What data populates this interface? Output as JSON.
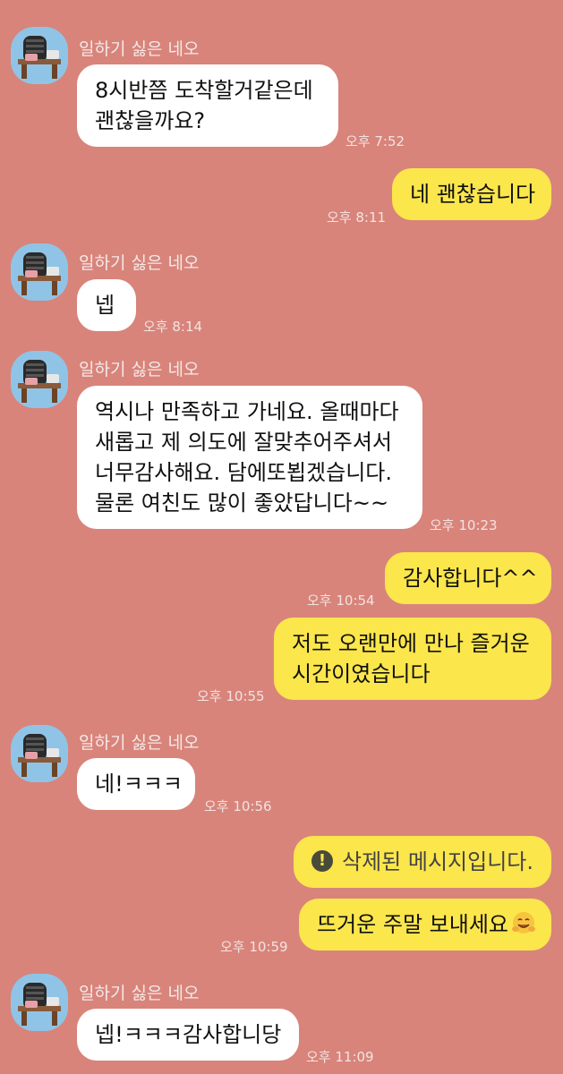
{
  "chat": {
    "sender_name": "일하기 싫은 네오",
    "messages": [
      {
        "lines": [
          "8시반쯤 도착할거같은데",
          "괜찮을까요?"
        ],
        "time": "오후 7:52"
      },
      {
        "lines": [
          "네 괜찮습니다"
        ],
        "time": "오후 8:11"
      },
      {
        "lines": [
          "넵"
        ],
        "time": "오후 8:14"
      },
      {
        "lines": [
          "역시나 만족하고 가네요. 올때마다",
          "새롭고 제 의도에 잘맞추어주셔서",
          "너무감사해요. 담에또뵙겠습니다.",
          "물론 여친도 많이 좋았답니다~~"
        ],
        "time": "오후 10:23"
      },
      {
        "lines": [
          "감사합니다^^"
        ],
        "time": "오후 10:54"
      },
      {
        "lines": [
          "저도 오랜만에 만나 즐거운",
          "시간이였습니다"
        ],
        "time": "오후 10:55"
      },
      {
        "lines": [
          "네!ㅋㅋㅋ"
        ],
        "time": "오후 10:56"
      },
      {
        "lines": [
          "삭제된 메시지입니다."
        ],
        "icon": "warning-icon"
      },
      {
        "lines": [
          "뜨거운 주말 보내세요"
        ],
        "emoji": "hugging-face-emoji",
        "time": "오후 10:59"
      },
      {
        "lines": [
          "넵!ㅋㅋㅋ감사합니당"
        ],
        "time": "오후 11:09"
      }
    ]
  },
  "colors": {
    "background": "#d8847b",
    "incoming_bubble": "#ffffff",
    "outgoing_bubble": "#fbe64c",
    "avatar_bg": "#8fc4e6"
  }
}
